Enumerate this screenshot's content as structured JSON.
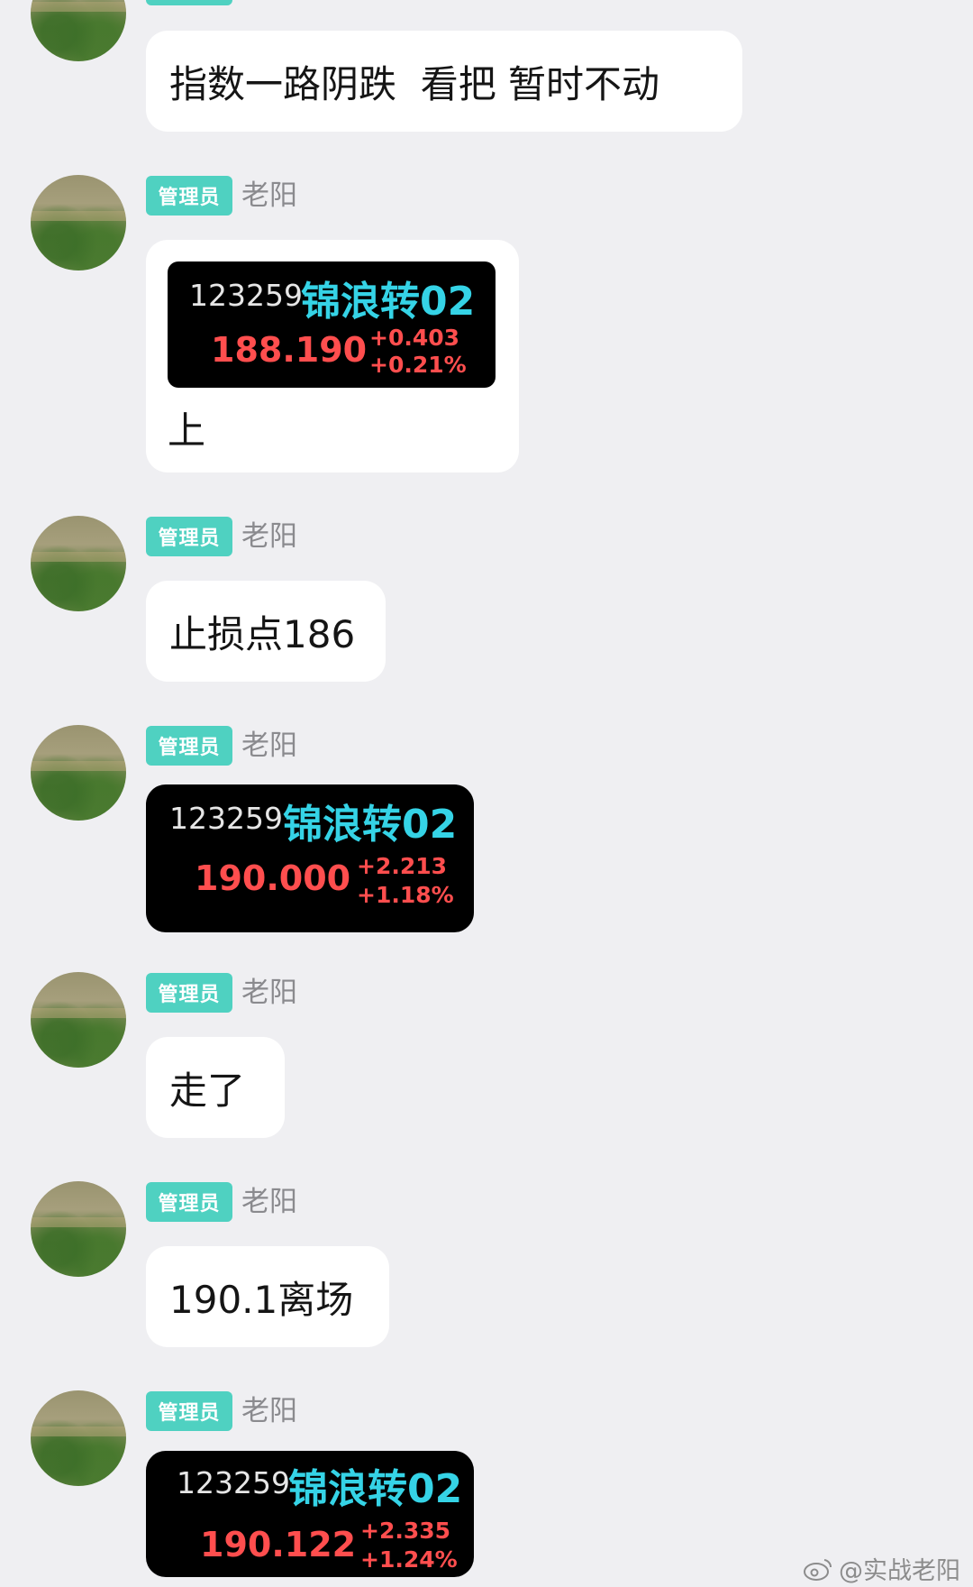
{
  "messages": [
    {
      "text": "指数一路阴跌  看把 暂时不动"
    },
    {
      "badge": "管理员",
      "sender": "老阳",
      "quote": {
        "code": "123259",
        "name": "锦浪转02",
        "price": "188.190",
        "change": "+0.403",
        "change_pct": "+0.21%"
      },
      "text": "上"
    },
    {
      "badge": "管理员",
      "sender": "老阳",
      "text": "止损点186"
    },
    {
      "badge": "管理员",
      "sender": "老阳",
      "quote": {
        "code": "123259",
        "name": "锦浪转02",
        "price": "190.000",
        "change": "+2.213",
        "change_pct": "+1.18%"
      }
    },
    {
      "badge": "管理员",
      "sender": "老阳",
      "text": "走了"
    },
    {
      "badge": "管理员",
      "sender": "老阳",
      "text": "190.1离场"
    },
    {
      "badge": "管理员",
      "sender": "老阳",
      "quote": {
        "code": "123259",
        "name": "锦浪转02",
        "price": "190.122",
        "change": "+2.335",
        "change_pct": "+1.24%"
      }
    }
  ],
  "watermark": "@实战老阳",
  "colors": {
    "background": "#efeff2",
    "badge": "#4fd1c1",
    "quote_name": "#35d3e6",
    "quote_up": "#ff4e4e"
  },
  "icons": {
    "watermark": "weibo-icon"
  }
}
